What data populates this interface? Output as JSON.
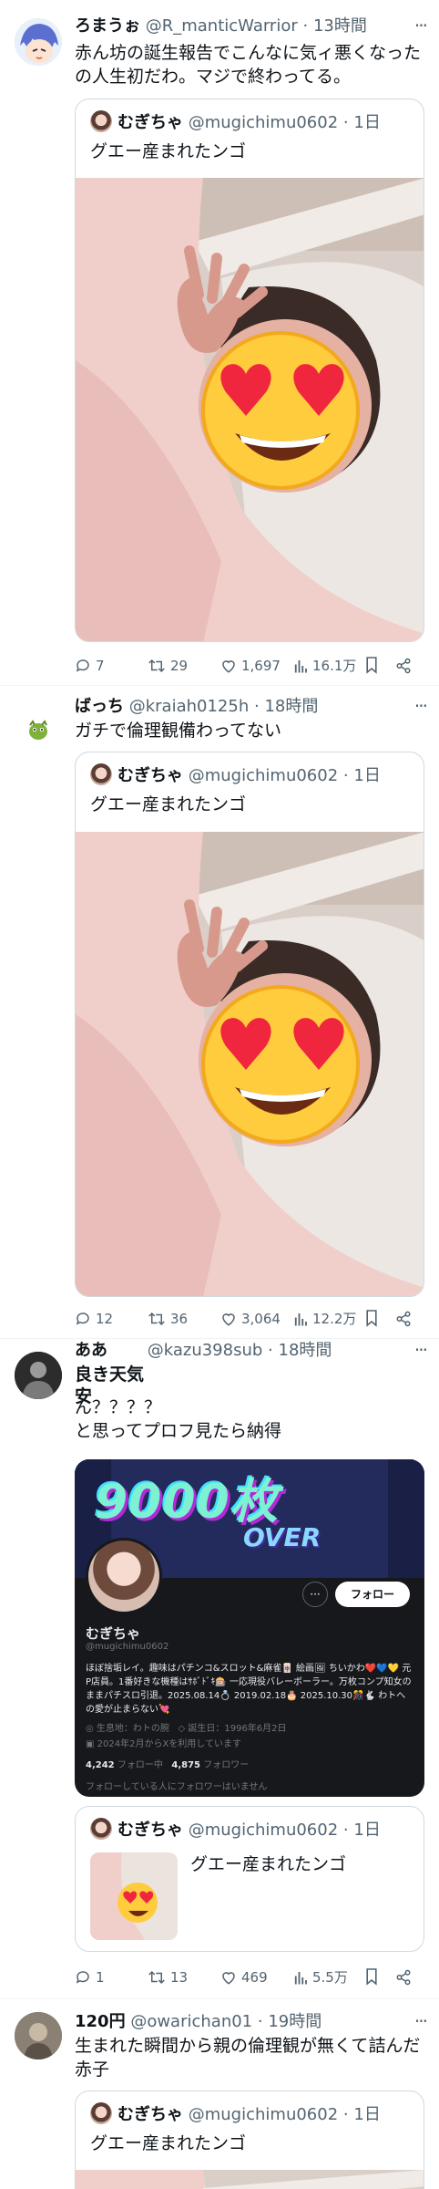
{
  "quoted_post": {
    "display_name": "むぎちゃ",
    "handle": "@mugichimu0602",
    "time": "1日",
    "text": "グエー産まれたンゴ",
    "emoji": "😍"
  },
  "tweets": [
    {
      "display_name": "ろまうぉ",
      "handle": "@R_manticWarrior",
      "time": "13時間",
      "text": "赤ん坊の誕生報告でこんなに気ィ悪くなったの人生初だわ。マジで終わってる。",
      "replies": "7",
      "retweets": "29",
      "likes": "1,697",
      "views": "16.1万"
    },
    {
      "display_name": "ばっち",
      "handle": "@kraiah0125h",
      "time": "18時間",
      "text": "ガチで倫理観備わってない",
      "replies": "12",
      "retweets": "36",
      "likes": "3,064",
      "views": "12.2万"
    },
    {
      "display_name": "ああ",
      "display_name_line2": "良き天気",
      "display_name_line3": "安",
      "handle": "@kazu398sub",
      "time": "18時間",
      "text_line1": "ん？？？？",
      "text_line2": "と思ってプロフ見たら納得",
      "replies": "1",
      "retweets": "13",
      "likes": "469",
      "views": "5.5万",
      "profile_card": {
        "banner_text": "9000枚",
        "banner_subtext": "OVER",
        "name": "むぎちゃ",
        "handle": "@mugichimu0602",
        "follow_label": "フォロー",
        "bio": "ほぼ捨垢レイ。趣味はパチンコ&スロット&麻雀🀄 絵画🖼 ちいかわ❤️💙💛 元P店員。1番好きな機種はｻﾎﾞﾄﾞｷ🎰 一応現役バレーボーラー。万枚コンプ知女のままパチスロ引退。2025.08.14💍 2019.02.18🎂 2025.10.30🎊🐇 わトへの愛が止まらない💘",
        "location": "生息地：わトの腕",
        "birthday": "誕生日：1996年6月2日",
        "joined": "2024年2月からXを利用しています",
        "following_count": "4,242",
        "following_label": "フォロー中",
        "followers_count": "4,875",
        "followers_label": "フォロワー",
        "footer": "フォローしている人にフォロワーはいません"
      }
    },
    {
      "display_name": "120円",
      "handle": "@owarichan01",
      "time": "19時間",
      "text": "生まれた瞬間から親の倫理観が無くて詰んだ赤子"
    }
  ],
  "icons": [
    "more-icon",
    "reply-icon",
    "retweet-icon",
    "like-icon",
    "views-icon",
    "bookmark-icon",
    "share-icon"
  ],
  "colors": {
    "text": "#0f1419",
    "secondary": "#536471",
    "border": "#cfd9de",
    "divider": "#eff3f4",
    "follow_button": "#ffffff",
    "card_bg": "#16181c"
  }
}
